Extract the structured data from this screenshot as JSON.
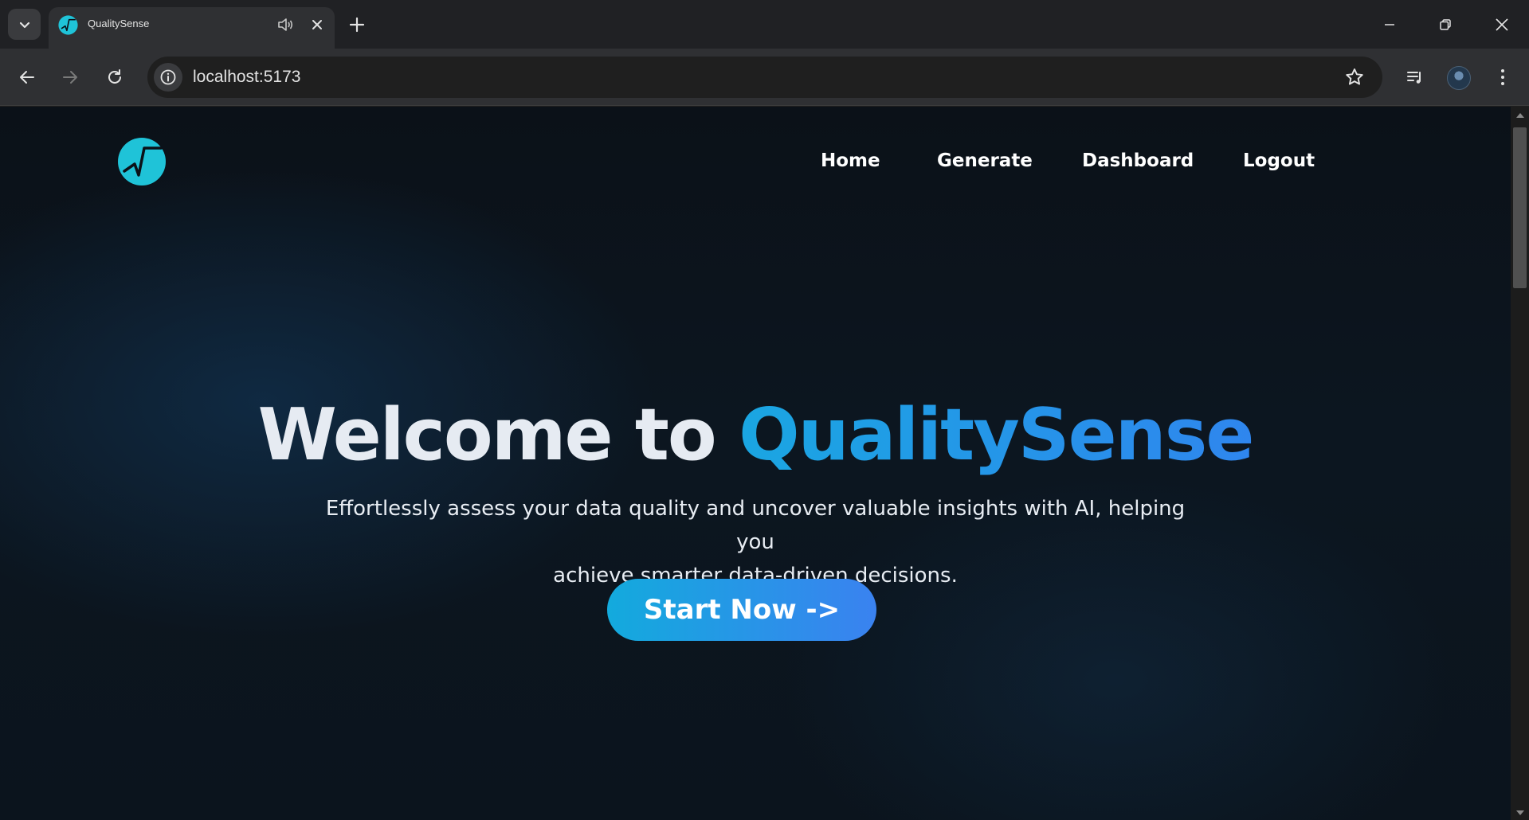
{
  "browser": {
    "tab": {
      "title": "QualitySense",
      "favicon": "qualitysense-logo-icon"
    },
    "omnibox": {
      "url": "localhost:5173"
    },
    "icons": [
      "tab-search-icon",
      "audio-icon",
      "close-icon",
      "new-tab-icon",
      "minimize-icon",
      "restore-icon",
      "window-close-icon",
      "back-icon",
      "forward-icon",
      "reload-icon",
      "site-info-icon",
      "bookmark-star-icon",
      "media-controls-icon",
      "avatar",
      "menu-dots-icon"
    ]
  },
  "site": {
    "nav": {
      "home": "Home",
      "generate": "Generate",
      "dashboard": "Dashboard",
      "logout": "Logout"
    },
    "hero": {
      "title_prefix": "Welcome to",
      "title_brand": "QualitySense",
      "subtitle_line1": "Effortlessly assess your data quality and uncover valuable insights with AI, helping you",
      "subtitle_line2": "achieve smarter data-driven decisions.",
      "cta": "Start Now ->"
    }
  },
  "colors": {
    "brand_accent": "#1aa6e2",
    "cta_gradient_start": "#13aadd",
    "cta_gradient_end": "#3a82f0",
    "page_background": "#0b141d"
  }
}
